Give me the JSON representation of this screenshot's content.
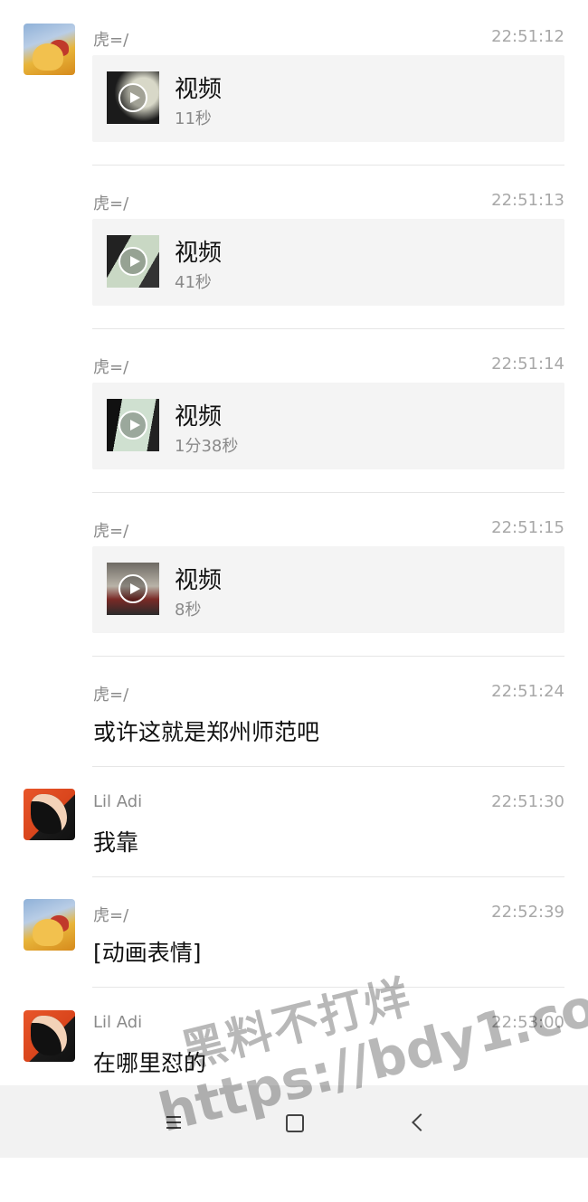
{
  "messages": [
    {
      "type": "video",
      "sender": "虎=/",
      "time": "22:51:12",
      "avatar": "pooh-avatar",
      "title": "视频",
      "duration": "11秒"
    },
    {
      "type": "video",
      "sender": "虎=/",
      "time": "22:51:13",
      "title": "视频",
      "duration": "41秒"
    },
    {
      "type": "video",
      "sender": "虎=/",
      "time": "22:51:14",
      "title": "视频",
      "duration": "1分38秒"
    },
    {
      "type": "video",
      "sender": "虎=/",
      "time": "22:51:15",
      "title": "视频",
      "duration": "8秒"
    },
    {
      "type": "text",
      "sender": "虎=/",
      "time": "22:51:24",
      "text": "或许这就是郑州师范吧"
    },
    {
      "type": "text",
      "sender": "Lil Adi",
      "time": "22:51:30",
      "avatar": "goku-avatar",
      "text": "我靠"
    },
    {
      "type": "text",
      "sender": "虎=/",
      "time": "22:52:39",
      "avatar": "pooh-avatar",
      "text": "[动画表情]"
    },
    {
      "type": "text",
      "sender": "Lil Adi",
      "time": "22:53:00",
      "avatar": "goku-avatar",
      "text": "在哪里怼的"
    }
  ],
  "navbar": {
    "icons": [
      "menu-icon",
      "home-icon",
      "back-icon"
    ]
  },
  "watermark": {
    "line1": "黑料不打烊",
    "line2": "https://bdy1.co"
  }
}
